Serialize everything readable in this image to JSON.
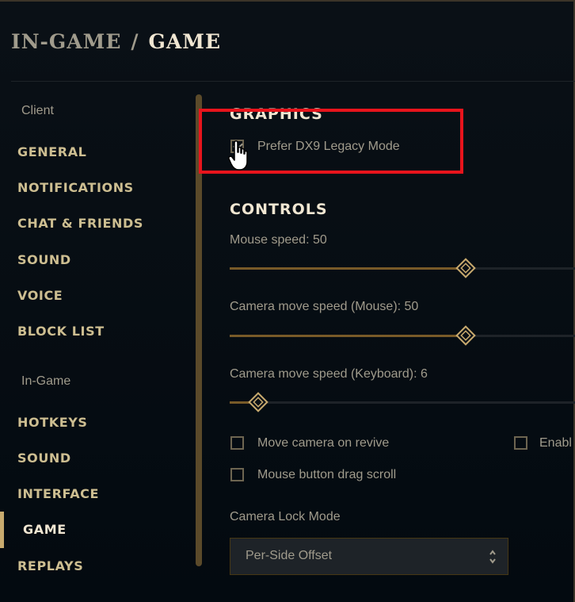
{
  "header": {
    "crumb": "IN-GAME",
    "separator": "/",
    "current": "GAME"
  },
  "sidebar": {
    "client_label": "Client",
    "client_items": [
      "GENERAL",
      "NOTIFICATIONS",
      "CHAT & FRIENDS",
      "SOUND",
      "VOICE",
      "BLOCK LIST"
    ],
    "ingame_label": "In-Game",
    "ingame_items": [
      "HOTKEYS",
      "SOUND",
      "INTERFACE",
      "GAME",
      "REPLAYS"
    ],
    "active_item": "GAME"
  },
  "graphics": {
    "heading": "GRAPHICS",
    "dx9_label": "Prefer DX9 Legacy Mode",
    "dx9_checked": true
  },
  "controls": {
    "heading": "CONTROLS",
    "sliders": [
      {
        "label": "Mouse speed: 50",
        "value": 50,
        "max": 100
      },
      {
        "label": "Camera move speed (Mouse): 50",
        "value": 50,
        "max": 100
      },
      {
        "label": "Camera move speed (Keyboard): 6",
        "value": 6,
        "max": 100
      }
    ],
    "checkboxes": [
      {
        "label": "Move camera on revive",
        "checked": false
      },
      {
        "label": "Enabl",
        "checked": false
      },
      {
        "label": "Mouse button drag scroll",
        "checked": false
      }
    ],
    "camera_lock_label": "Camera Lock Mode",
    "camera_lock_value": "Per-Side Offset"
  },
  "colors": {
    "gold": "#c8aa6e",
    "highlight": "#e8141c",
    "background": "#010a13"
  }
}
